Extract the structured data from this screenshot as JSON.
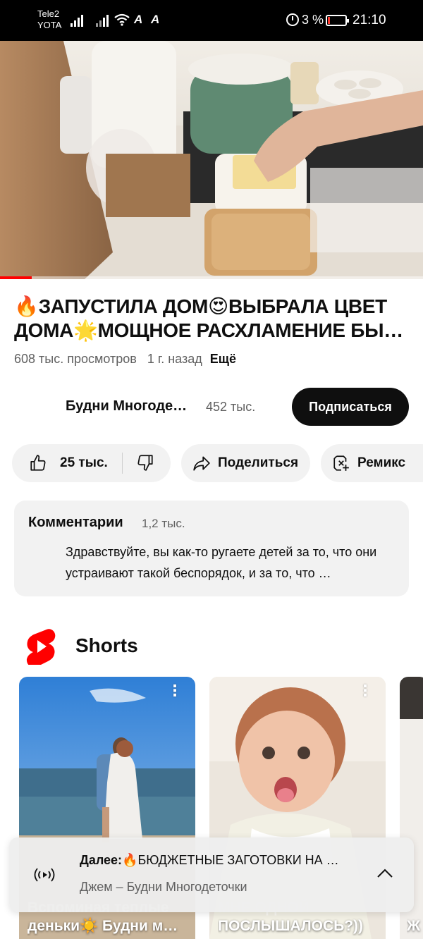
{
  "status_bar": {
    "carrier_1": "Tele2",
    "carrier_2": "YOTA",
    "battery": "3 %",
    "time": "21:10"
  },
  "video": {
    "progress": 0.075,
    "accent_color": "#ff0000",
    "title": "🔥ЗАПУСТИЛА ДОМ😍ВЫБРАЛА ЦВЕТ ДОМА🌟МОЩНОЕ РАСХЛАМЕНИЕ БЫ…",
    "views": "608 тыс. просмотров",
    "age": "1 г. назад",
    "more": "Ещё"
  },
  "channel": {
    "name": "Будни Многоде…",
    "subscribers": "452 тыс.",
    "subscribe_label": "Подписаться"
  },
  "actions": {
    "likes": "25 тыс.",
    "share": "Поделиться",
    "remix": "Ремикс"
  },
  "comments": {
    "title": "Комментарии",
    "count": "1,2 тыс.",
    "top_comment": "Здравствуйте, вы как-то ругаете детей за то, что они устраивают такой беспорядок, и за то, что …"
  },
  "shorts": {
    "title": "Shorts",
    "items": [
      {
        "caption_faded": "Вспоминая теплые",
        "caption": "деньки☀️ Будни м…"
      },
      {
        "caption_faded": "МНЕ ОДНОЙ",
        "caption": "ПОСЛЫШАЛОСЬ?))"
      },
      {
        "caption": "Ж"
      }
    ]
  },
  "mini_player": {
    "next_label": "Далее:",
    "next_title": "🔥БЮДЖЕТНЫЕ ЗАГОТОВКИ НА …",
    "subtitle": "Джем – Будни Многодеточки"
  }
}
